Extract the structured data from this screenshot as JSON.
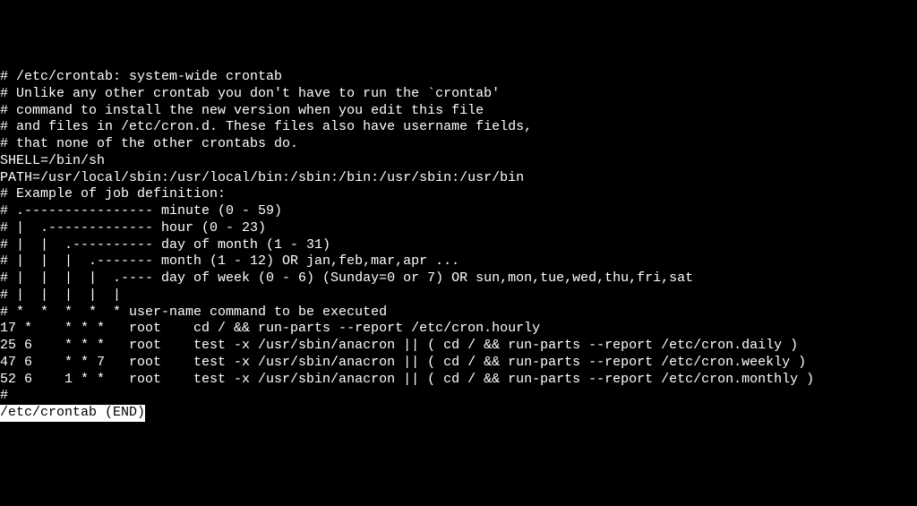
{
  "lines": [
    "# /etc/crontab: system-wide crontab",
    "# Unlike any other crontab you don't have to run the `crontab'",
    "# command to install the new version when you edit this file",
    "# and files in /etc/cron.d. These files also have username fields,",
    "# that none of the other crontabs do.",
    "",
    "SHELL=/bin/sh",
    "PATH=/usr/local/sbin:/usr/local/bin:/sbin:/bin:/usr/sbin:/usr/bin",
    "",
    "# Example of job definition:",
    "# .---------------- minute (0 - 59)",
    "# |  .------------- hour (0 - 23)",
    "# |  |  .---------- day of month (1 - 31)",
    "# |  |  |  .------- month (1 - 12) OR jan,feb,mar,apr ...",
    "# |  |  |  |  .---- day of week (0 - 6) (Sunday=0 or 7) OR sun,mon,tue,wed,thu,fri,sat",
    "# |  |  |  |  |",
    "# *  *  *  *  * user-name command to be executed",
    "17 *    * * *   root    cd / && run-parts --report /etc/cron.hourly",
    "25 6    * * *   root    test -x /usr/sbin/anacron || ( cd / && run-parts --report /etc/cron.daily )",
    "47 6    * * 7   root    test -x /usr/sbin/anacron || ( cd / && run-parts --report /etc/cron.weekly )",
    "52 6    1 * *   root    test -x /usr/sbin/anacron || ( cd / && run-parts --report /etc/cron.monthly )",
    "#"
  ],
  "status": "/etc/crontab (END)"
}
